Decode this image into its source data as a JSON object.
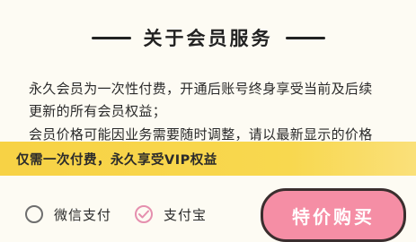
{
  "section": {
    "title": "关于会员服务"
  },
  "description": {
    "paragraph1_line1": "永久会员为一次性付费，开通后账号终身享受当前及后续",
    "paragraph1_line2": "更新的所有会员权益；",
    "paragraph2_line1": "会员价格可能因业务需要随时调整，请以最新显示的价格"
  },
  "banner": {
    "text": "仅需一次付费，永久享受VIP权益"
  },
  "payment": {
    "options": [
      {
        "label": "微信支付",
        "selected": false
      },
      {
        "label": "支付宝",
        "selected": true
      }
    ]
  },
  "buy_button": {
    "label": "特价购买"
  },
  "colors": {
    "background": "#fdfbf3",
    "banner": "#f7d245",
    "button": "#f58ea5",
    "selected_check": "#e58fae"
  }
}
